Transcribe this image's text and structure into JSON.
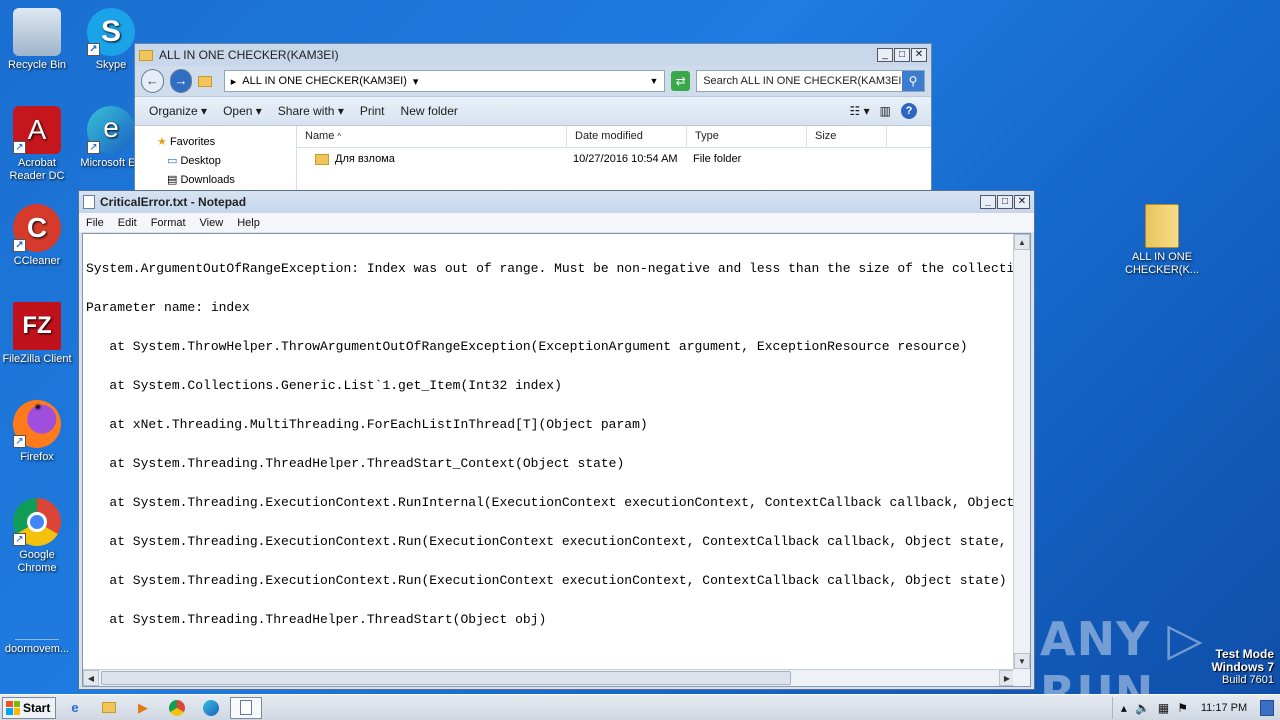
{
  "desktop": {
    "icons": [
      {
        "label": "Recycle Bin",
        "glyph": "🗑"
      },
      {
        "label": "Skype",
        "glyph": "S"
      },
      {
        "label": "Acrobat Reader DC",
        "glyph": "A"
      },
      {
        "label": "Microsoft Ed",
        "glyph": "e"
      },
      {
        "label": "CCleaner",
        "glyph": "C"
      },
      {
        "label": "FileZilla Client",
        "glyph": "FZ"
      },
      {
        "label": "Firefox",
        "glyph": "●"
      },
      {
        "label": "Google Chrome",
        "glyph": "◉"
      },
      {
        "label": "doornovem...",
        "glyph": ""
      },
      {
        "label": "ALL IN ONE CHECKER(K...",
        "glyph": ""
      }
    ],
    "colors": {
      "background": "#1a6fd0"
    }
  },
  "explorer": {
    "title": "ALL IN ONE CHECKER(KAM3EI)",
    "address": "ALL IN ONE CHECKER(KAM3EI)",
    "search_placeholder": "Search ALL IN ONE CHECKER(KAM3EI)",
    "toolbar": {
      "organize": "Organize",
      "open": "Open",
      "share_with": "Share with",
      "print": "Print",
      "new_folder": "New folder"
    },
    "nav": {
      "favorites": "Favorites",
      "desktop": "Desktop",
      "downloads": "Downloads"
    },
    "columns": {
      "name": "Name",
      "date": "Date modified",
      "type": "Type",
      "size": "Size"
    },
    "rows": [
      {
        "name": "Для взлома",
        "date": "10/27/2016 10:54 AM",
        "type": "File folder",
        "size": ""
      }
    ]
  },
  "notepad": {
    "title": "CriticalError.txt - Notepad",
    "menu": {
      "file": "File",
      "edit": "Edit",
      "format": "Format",
      "view": "View",
      "help": "Help"
    },
    "lines": [
      "System.ArgumentOutOfRangeException: Index was out of range. Must be non-negative and less than the size of the collection.",
      "Parameter name: index",
      "   at System.ThrowHelper.ThrowArgumentOutOfRangeException(ExceptionArgument argument, ExceptionResource resource)",
      "   at System.Collections.Generic.List`1.get_Item(Int32 index)",
      "   at xNet.Threading.MultiThreading.ForEachListInThread[T](Object param)",
      "   at System.Threading.ThreadHelper.ThreadStart_Context(Object state)",
      "   at System.Threading.ExecutionContext.RunInternal(ExecutionContext executionContext, ContextCallback callback, Object state, Boolean preserveSyncCtx)",
      "   at System.Threading.ExecutionContext.Run(ExecutionContext executionContext, ContextCallback callback, Object state, Boolean preserveSyncCtx)",
      "   at System.Threading.ExecutionContext.Run(ExecutionContext executionContext, ContextCallback callback, Object state)",
      "   at System.Threading.ThreadHelper.ThreadStart(Object obj)"
    ]
  },
  "watermark": "ANY ▷ RUN",
  "testmode": {
    "line1": "Test Mode",
    "line2": "Windows 7",
    "line3": "Build 7601"
  },
  "taskbar": {
    "start": "Start",
    "clock": "11:17 PM",
    "items": [
      "ie-icon",
      "explorer-icon",
      "media-player-icon",
      "chrome-icon",
      "edge-icon",
      "notepad-icon"
    ]
  }
}
